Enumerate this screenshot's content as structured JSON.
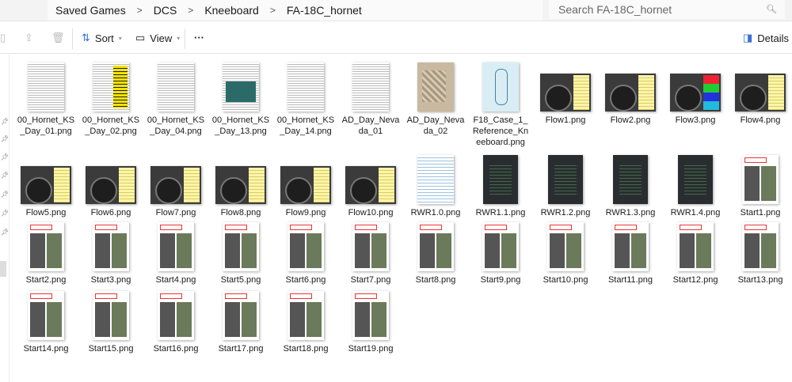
{
  "breadcrumb": [
    "Saved Games",
    "DCS",
    "Kneeboard",
    "FA-18C_hornet"
  ],
  "search": {
    "placeholder": "Search FA-18C_hornet"
  },
  "toolbar": {
    "sort": "Sort",
    "view": "View",
    "more": "···",
    "details": "Details"
  },
  "files": [
    {
      "name": "00_Hornet_KS_Day_01.png",
      "kind": "doc"
    },
    {
      "name": "00_Hornet_KS_Day_02.png",
      "kind": "doc y"
    },
    {
      "name": "00_Hornet_KS_Day_04.png",
      "kind": "doc"
    },
    {
      "name": "00_Hornet_KS_Day_13.png",
      "kind": "doc t"
    },
    {
      "name": "00_Hornet_KS_Day_14.png",
      "kind": "doc"
    },
    {
      "name": "AD_Day_Nevada_01",
      "kind": "doc"
    },
    {
      "name": "AD_Day_Nevada_02",
      "kind": "doc map"
    },
    {
      "name": "F18_Case_1_Reference_Kneeboard.png",
      "kind": "doc case"
    },
    {
      "name": "Flow1.png",
      "kind": "cock"
    },
    {
      "name": "Flow2.png",
      "kind": "cock"
    },
    {
      "name": "Flow3.png",
      "kind": "cock rgb"
    },
    {
      "name": "Flow4.png",
      "kind": "cock"
    },
    {
      "name": "Flow5.png",
      "kind": "cock"
    },
    {
      "name": "Flow6.png",
      "kind": "cock"
    },
    {
      "name": "Flow7.png",
      "kind": "cock"
    },
    {
      "name": "Flow8.png",
      "kind": "cock"
    },
    {
      "name": "Flow9.png",
      "kind": "cock"
    },
    {
      "name": "Flow10.png",
      "kind": "cock"
    },
    {
      "name": "RWR1.0.png",
      "kind": "rwr0"
    },
    {
      "name": "RWR1.1.png",
      "kind": "rwr"
    },
    {
      "name": "RWR1.2.png",
      "kind": "rwr"
    },
    {
      "name": "RWR1.3.png",
      "kind": "rwr"
    },
    {
      "name": "RWR1.4.png",
      "kind": "rwr"
    },
    {
      "name": "Start1.png",
      "kind": "start"
    },
    {
      "name": "Start2.png",
      "kind": "start"
    },
    {
      "name": "Start3.png",
      "kind": "start"
    },
    {
      "name": "Start4.png",
      "kind": "start"
    },
    {
      "name": "Start5.png",
      "kind": "start"
    },
    {
      "name": "Start6.png",
      "kind": "start"
    },
    {
      "name": "Start7.png",
      "kind": "start"
    },
    {
      "name": "Start8.png",
      "kind": "start"
    },
    {
      "name": "Start9.png",
      "kind": "start"
    },
    {
      "name": "Start10.png",
      "kind": "start"
    },
    {
      "name": "Start11.png",
      "kind": "start"
    },
    {
      "name": "Start12.png",
      "kind": "start"
    },
    {
      "name": "Start13.png",
      "kind": "start"
    },
    {
      "name": "Start14.png",
      "kind": "start"
    },
    {
      "name": "Start15.png",
      "kind": "start"
    },
    {
      "name": "Start16.png",
      "kind": "start"
    },
    {
      "name": "Start17.png",
      "kind": "start"
    },
    {
      "name": "Start18.png",
      "kind": "start"
    },
    {
      "name": "Start19.png",
      "kind": "start"
    }
  ]
}
